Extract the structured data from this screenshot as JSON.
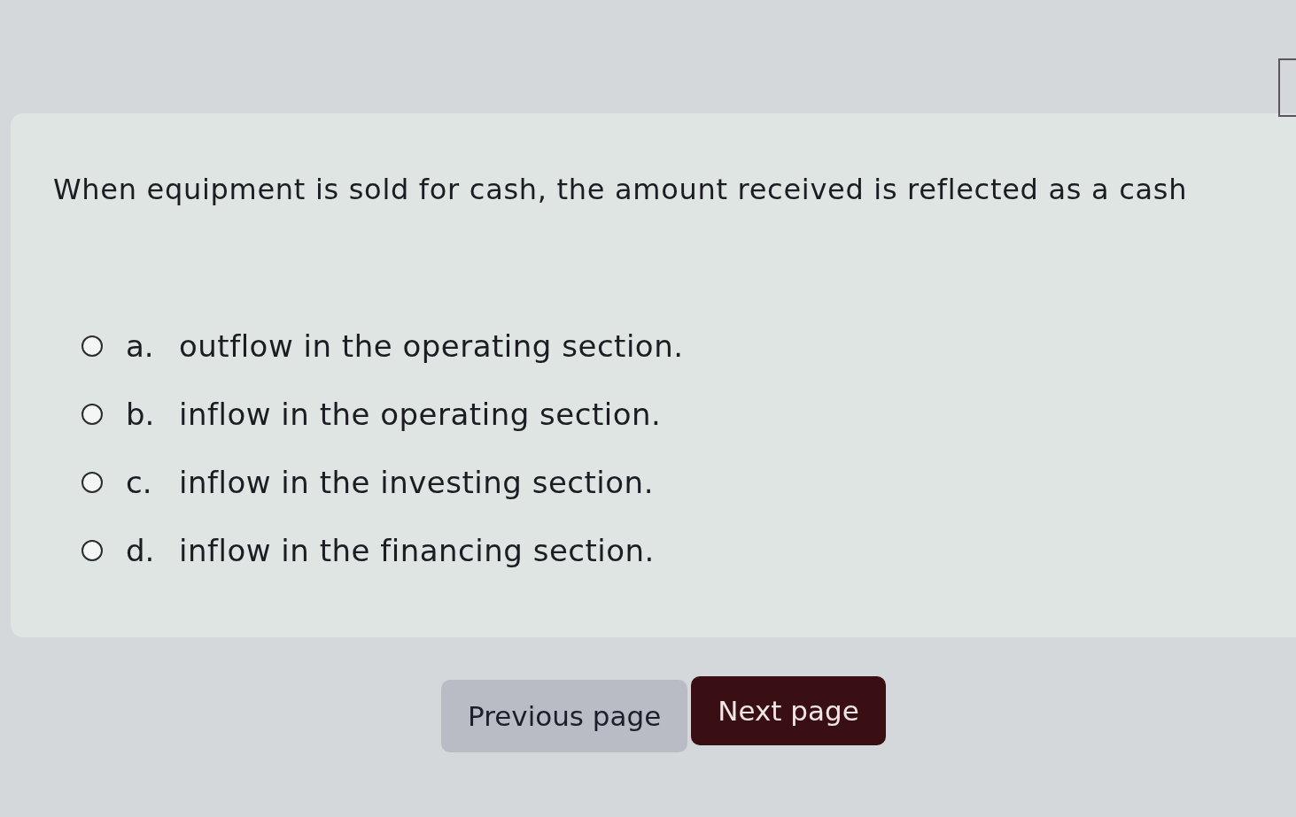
{
  "question": {
    "text": "When equipment is sold for cash, the amount received is reflected as a cash"
  },
  "options": [
    {
      "letter": "a.",
      "text": "outflow in the operating section.",
      "selected": false
    },
    {
      "letter": "b.",
      "text": "inflow in the operating section.",
      "selected": false
    },
    {
      "letter": "c.",
      "text": "inflow in the investing section.",
      "selected": false
    },
    {
      "letter": "d.",
      "text": "inflow in the financing section.",
      "selected": false
    }
  ],
  "buttons": [
    {
      "label": "Previous page",
      "kind": "secondary"
    },
    {
      "label": "Next page",
      "kind": "primary"
    }
  ]
}
